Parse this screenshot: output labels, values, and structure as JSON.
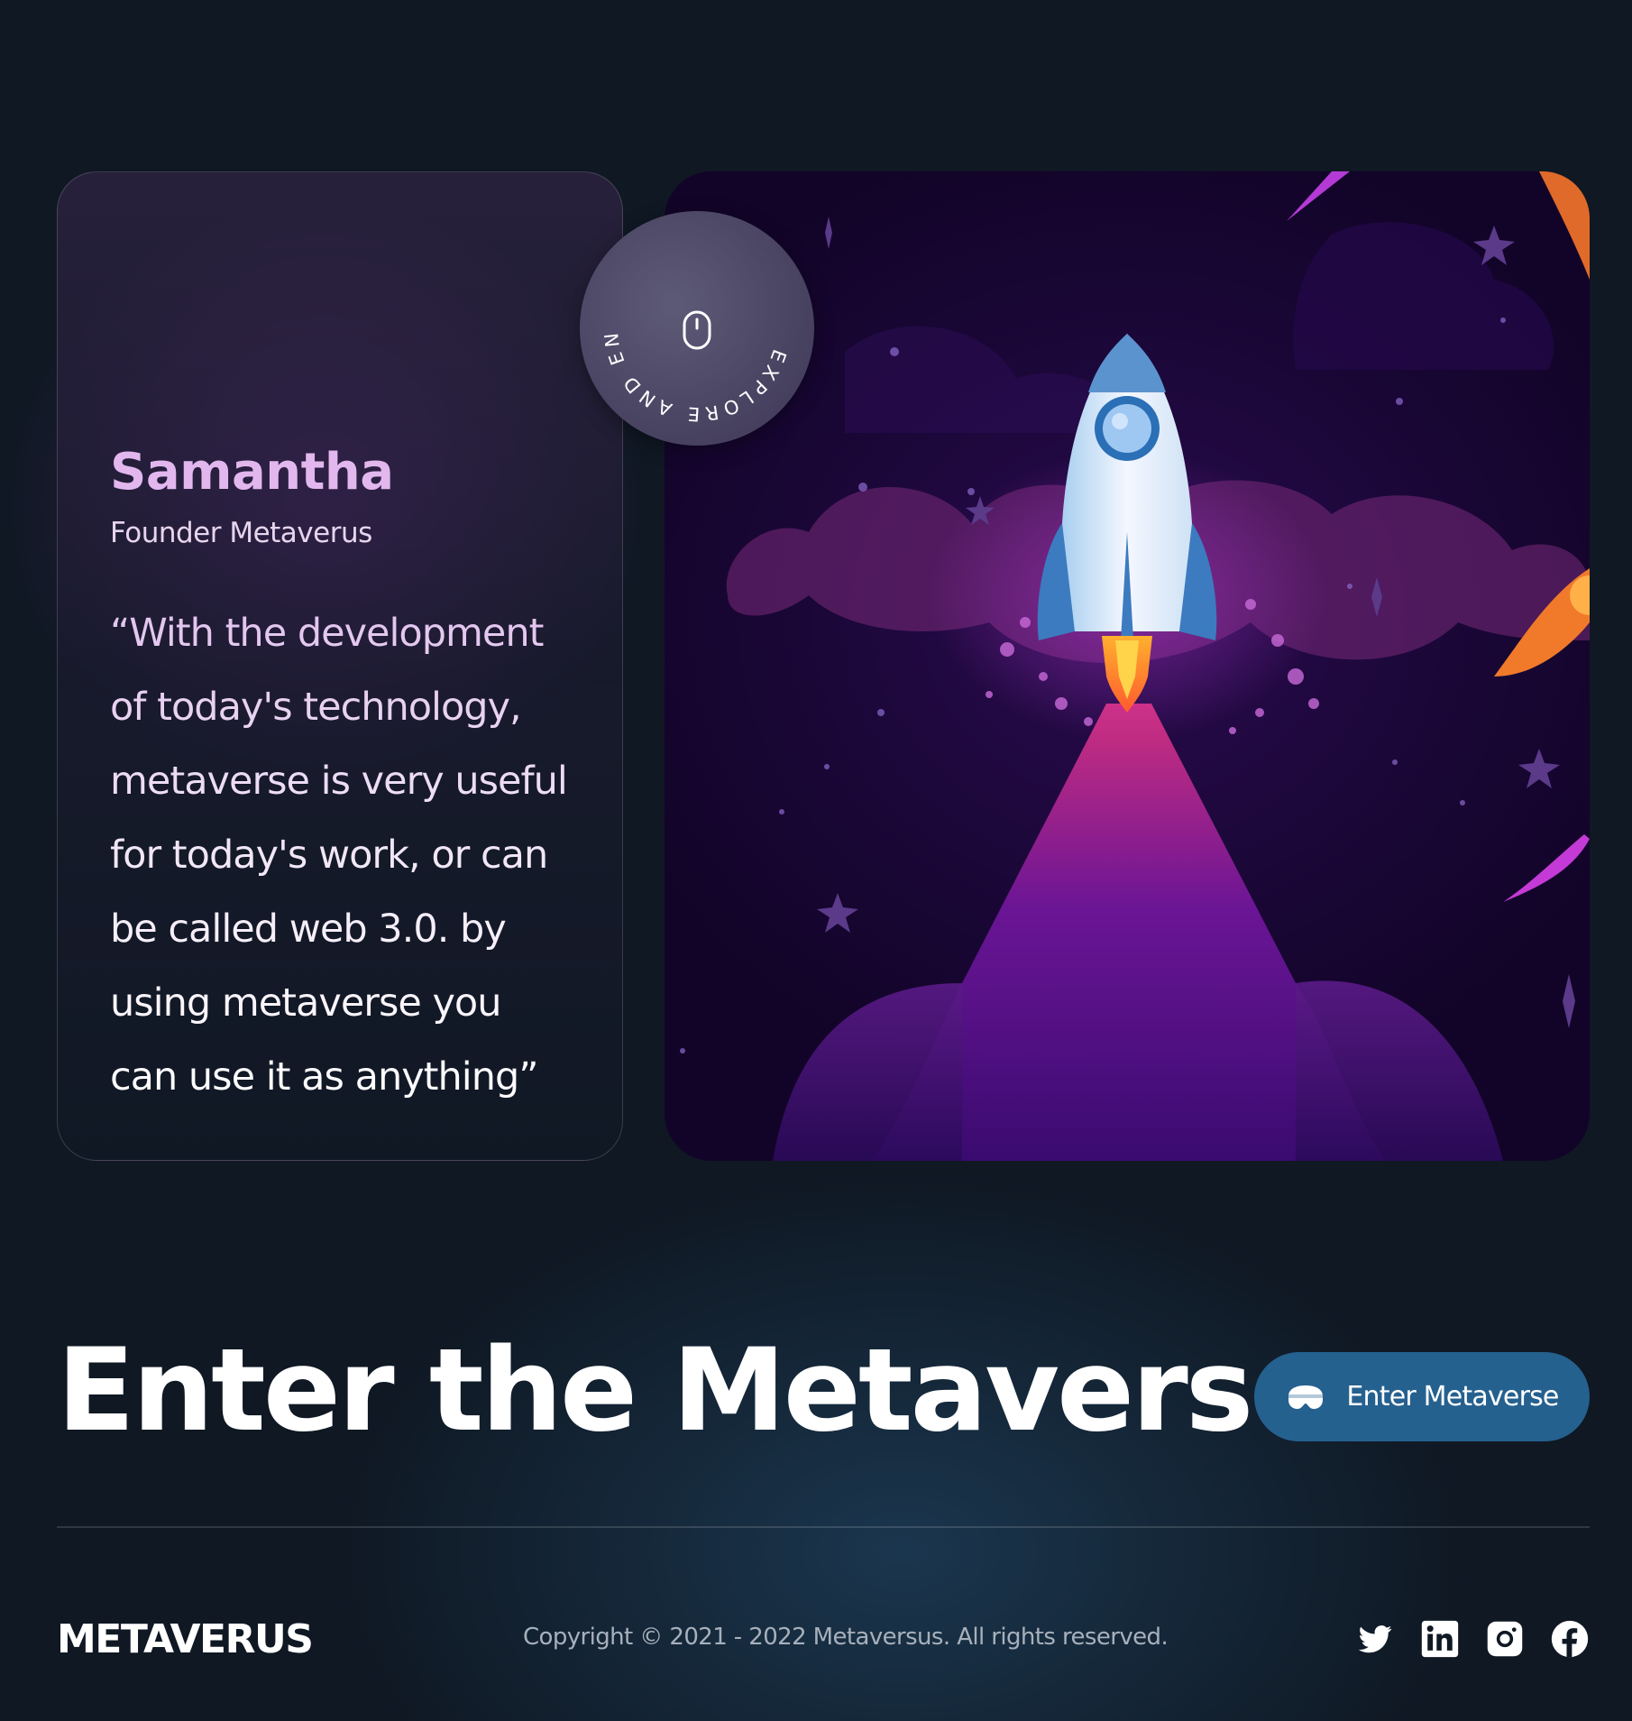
{
  "testimonial": {
    "name": "Samantha",
    "role": "Founder Metaverus",
    "quote": "“With the development of today's technology, metaverse is very useful for today's work, or can be called web 3.0. by using metaverse you can use it as anything”"
  },
  "badge": {
    "text": "EXPLORE AND ENTER THE METAVERSE",
    "icon": "mouse-icon"
  },
  "cta": {
    "title": "Enter the Metaverse",
    "button_label": "Enter Metaverse",
    "button_icon": "vr-headset-icon"
  },
  "footer": {
    "brand": "METAVERUS",
    "copyright": "Copyright © 2021 - 2022 Metaversus. All rights reserved.",
    "social": [
      "twitter-icon",
      "linkedin-icon",
      "instagram-icon",
      "facebook-icon"
    ]
  },
  "colors": {
    "background": "#0f1823",
    "name_accent": "#e2b7ee",
    "button": "#25618f",
    "copyright": "#a7b0bb"
  }
}
